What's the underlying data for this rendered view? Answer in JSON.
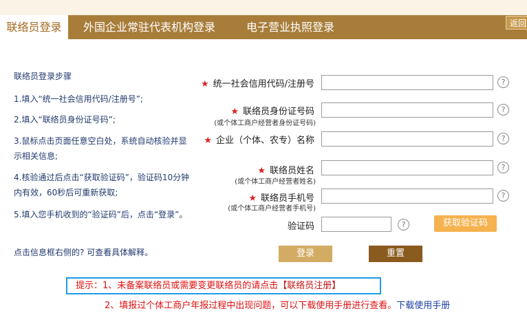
{
  "tabs": [
    {
      "label": "联络员登录"
    },
    {
      "label": "外国企业常驻代表机构登录"
    },
    {
      "label": "电子营业执照登录"
    }
  ],
  "back_label": "返回",
  "steps": {
    "title": "联络员登录步骤",
    "items": [
      "1.填入“统一社会信用代码/注册号”;",
      "2.填入“联络员身份证号码”;",
      "3.鼠标点击页面任意空白处，系统自动核验并显示相关信息;",
      "4.核验通过后点击“获取验证码”，验证码10分钟内有效，60秒后可重新获取;",
      "5.填入您手机收到的“验证码”后，点击“登录”。",
      "点击信息框右侧的? 可查看具体解释。"
    ]
  },
  "form": {
    "credit_code_label": "统一社会信用代码/注册号",
    "id_label": "联络员身份证号码",
    "id_sub": "(或个体工商户经营者身份证号码)",
    "company_label": "企业（个体、农专）名称",
    "name_label": "联络员姓名",
    "name_sub": "(或个体工商户经营者姓名)",
    "phone_label": "联络员手机号",
    "phone_sub": "(或个体工商户经营者手机号)",
    "captcha_label": "验证码",
    "get_code_label": "获取验证码",
    "login_label": "登录",
    "reset_label": "重置",
    "help_glyph": "?",
    "star": "★"
  },
  "notice": {
    "line1_prefix": "提示：1、未备案联络员或需要变更联络员的请点击",
    "line1_link": "【联络员注册】",
    "line2": "2、填报过个体工商户年报过程中出现问题，可以下载使用手册进行查看。",
    "line2_link": "下载使用手册"
  },
  "colors": {
    "tab_bar": "#a87d3a",
    "active_tab_text": "#a5691f",
    "steps_text": "#223a6e",
    "tip_border": "#1e9be6",
    "tip_text": "#e01010",
    "get_code_btn": "#f5b24e",
    "login_btn": "#d3ac63",
    "reset_btn": "#8a5b1e"
  }
}
